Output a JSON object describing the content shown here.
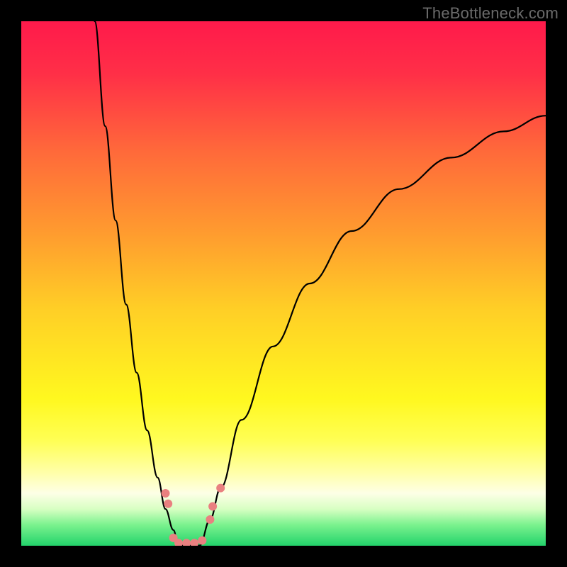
{
  "watermark": "TheBottleneck.com",
  "chart_data": {
    "type": "line",
    "title": "",
    "xlabel": "",
    "ylabel": "",
    "xlim": [
      0,
      100
    ],
    "ylim": [
      0,
      100
    ],
    "grid": false,
    "legend": false,
    "gradient_stops": [
      {
        "offset": 0.0,
        "color": "#ff1a4b"
      },
      {
        "offset": 0.1,
        "color": "#ff2f47"
      },
      {
        "offset": 0.25,
        "color": "#ff6a3a"
      },
      {
        "offset": 0.4,
        "color": "#ff9a2f"
      },
      {
        "offset": 0.55,
        "color": "#ffcf26"
      },
      {
        "offset": 0.72,
        "color": "#fff81f"
      },
      {
        "offset": 0.8,
        "color": "#ffff55"
      },
      {
        "offset": 0.86,
        "color": "#ffffa8"
      },
      {
        "offset": 0.9,
        "color": "#fdffe6"
      },
      {
        "offset": 0.93,
        "color": "#d8ffc3"
      },
      {
        "offset": 0.96,
        "color": "#7bf28e"
      },
      {
        "offset": 1.0,
        "color": "#23d36b"
      }
    ],
    "series": [
      {
        "name": "left-branch",
        "x": [
          14.0,
          16.0,
          18.0,
          20.0,
          22.0,
          24.0,
          26.0,
          27.5,
          29.0,
          30.0
        ],
        "y": [
          100.0,
          80.0,
          62.0,
          46.0,
          33.0,
          22.0,
          13.0,
          7.0,
          3.0,
          0.0
        ]
      },
      {
        "name": "right-branch",
        "x": [
          34.0,
          36.0,
          38.0,
          42.0,
          48.0,
          55.0,
          63.0,
          72.0,
          82.0,
          92.0,
          100.0
        ],
        "y": [
          0.0,
          5.0,
          11.0,
          24.0,
          38.0,
          50.0,
          60.0,
          68.0,
          74.0,
          79.0,
          82.0
        ]
      },
      {
        "name": "valley-floor",
        "x": [
          30.0,
          31.0,
          32.0,
          33.0,
          34.0
        ],
        "y": [
          0.0,
          0.0,
          0.0,
          0.0,
          0.0
        ]
      }
    ],
    "markers": [
      {
        "x": 27.5,
        "y": 10.0,
        "r": 6,
        "color": "#e98080"
      },
      {
        "x": 28.0,
        "y": 8.0,
        "r": 6,
        "color": "#e98080"
      },
      {
        "x": 29.0,
        "y": 1.5,
        "r": 6,
        "color": "#e98080"
      },
      {
        "x": 30.0,
        "y": 0.5,
        "r": 6,
        "color": "#e98080"
      },
      {
        "x": 31.5,
        "y": 0.5,
        "r": 6,
        "color": "#e98080"
      },
      {
        "x": 33.0,
        "y": 0.5,
        "r": 6,
        "color": "#e98080"
      },
      {
        "x": 34.5,
        "y": 1.0,
        "r": 6,
        "color": "#e98080"
      },
      {
        "x": 36.0,
        "y": 5.0,
        "r": 6,
        "color": "#e98080"
      },
      {
        "x": 36.5,
        "y": 7.5,
        "r": 6,
        "color": "#e98080"
      },
      {
        "x": 38.0,
        "y": 11.0,
        "r": 6,
        "color": "#e98080"
      }
    ]
  }
}
